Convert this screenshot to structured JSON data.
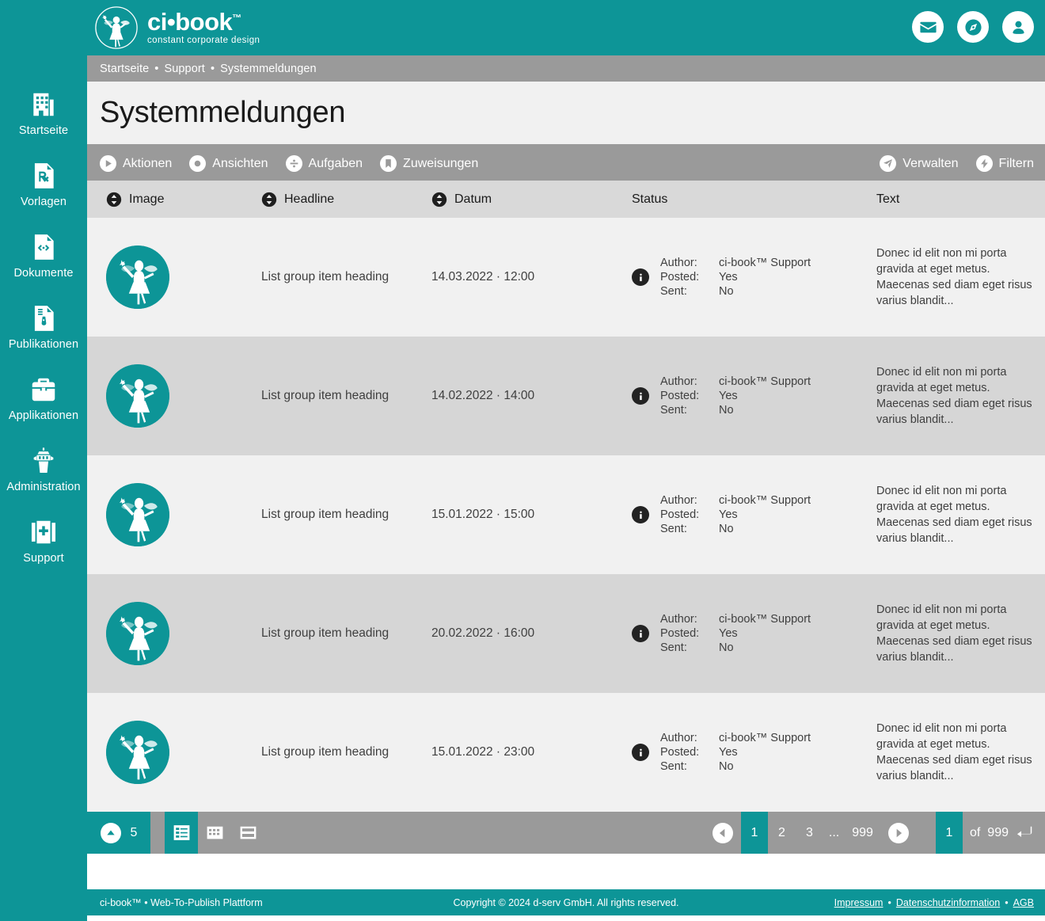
{
  "brand": {
    "name": "ci•book",
    "tm": "™",
    "tagline": "constant corporate design",
    "accent": "#0d9597",
    "toolbar_gray": "#9a9a9a",
    "row_light": "#f1f1f1",
    "row_dark": "#d6d6d6"
  },
  "header": {
    "icons": [
      {
        "name": "mail-icon",
        "label": "Nachrichten"
      },
      {
        "name": "compass-icon",
        "label": "Navigator"
      },
      {
        "name": "user-icon",
        "label": "Benutzerkonto"
      }
    ]
  },
  "sidebar": {
    "items": [
      {
        "label": "Startseite",
        "icon": "building-icon"
      },
      {
        "label": "Vorlagen",
        "icon": "prescription-document-icon"
      },
      {
        "label": "Dokumente",
        "icon": "code-document-icon"
      },
      {
        "label": "Publikationen",
        "icon": "publication-document-icon"
      },
      {
        "label": "Applikationen",
        "icon": "toolbox-icon"
      },
      {
        "label": "Administration",
        "icon": "control-tower-icon"
      },
      {
        "label": "Support",
        "icon": "first-aid-icon"
      }
    ]
  },
  "breadcrumb": {
    "items": [
      "Startseite",
      "Support",
      "Systemmeldungen"
    ],
    "separator": "•"
  },
  "page": {
    "title": "Systemmeldungen"
  },
  "toolbar": {
    "left": [
      {
        "label": "Aktionen",
        "icon": "play-circle-icon"
      },
      {
        "label": "Ansichten",
        "icon": "dot-circle-icon"
      },
      {
        "label": "Aufgaben",
        "icon": "divide-circle-icon"
      },
      {
        "label": "Zuweisungen",
        "icon": "bookmark-circle-icon"
      }
    ],
    "right": [
      {
        "label": "Verwalten",
        "icon": "paper-plane-circle-icon"
      },
      {
        "label": "Filtern",
        "icon": "bolt-circle-icon"
      }
    ]
  },
  "table": {
    "columns": [
      {
        "label": "Image",
        "sortable": true
      },
      {
        "label": "Headline",
        "sortable": true
      },
      {
        "label": "Datum",
        "sortable": true
      },
      {
        "label": "Status",
        "sortable": false
      },
      {
        "label": "Text",
        "sortable": false
      }
    ],
    "status_labels": {
      "author": "Author:",
      "posted": "Posted:",
      "sent": "Sent:"
    },
    "rows": [
      {
        "image": "fairy-avatar",
        "headline": "List group item heading",
        "date": "14.03.2022 · 12:00",
        "author": "ci-book™ Support",
        "posted": "Yes",
        "sent": "No",
        "text": "Donec id elit non mi porta gravida at eget metus. Maecenas sed diam eget risus varius blandit..."
      },
      {
        "image": "fairy-avatar",
        "headline": "List group item heading",
        "date": "14.02.2022 · 14:00",
        "author": "ci-book™ Support",
        "posted": "Yes",
        "sent": "No",
        "text": "Donec id elit non mi porta gravida at eget metus. Maecenas sed diam eget risus varius blandit..."
      },
      {
        "image": "fairy-avatar",
        "headline": "List group item heading",
        "date": "15.01.2022 · 15:00",
        "author": "ci-book™ Support",
        "posted": "Yes",
        "sent": "No",
        "text": "Donec id elit non mi porta gravida at eget metus. Maecenas sed diam eget risus varius blandit..."
      },
      {
        "image": "fairy-avatar",
        "headline": "List group item heading",
        "date": "20.02.2022 · 16:00",
        "author": "ci-book™ Support",
        "posted": "Yes",
        "sent": "No",
        "text": "Donec id elit non mi porta gravida at eget metus. Maecenas sed diam eget risus varius blandit..."
      },
      {
        "image": "fairy-avatar",
        "headline": "List group item heading",
        "date": "15.01.2022 · 23:00",
        "author": "ci-book™ Support",
        "posted": "Yes",
        "sent": "No",
        "text": "Donec id elit non mi porta gravida at eget metus. Maecenas sed diam eget risus varius blandit..."
      }
    ]
  },
  "pagination": {
    "page_size": "5",
    "views": [
      {
        "name": "list-view-icon",
        "active": true
      },
      {
        "name": "grid-view-icon",
        "active": false
      },
      {
        "name": "detail-view-icon",
        "active": false
      }
    ],
    "pages": [
      "1",
      "2",
      "3"
    ],
    "ellipsis": "...",
    "last_page": "999",
    "current_page": "1",
    "jump_value": "1",
    "of_label": "of",
    "total_pages": "999"
  },
  "footer": {
    "left": "ci-book™ • Web-To-Publish Plattform",
    "center": "Copyright © 2024 d-serv GmbH. All rights reserved.",
    "links": [
      "Impressum",
      "Datenschutzinformation",
      "AGB"
    ],
    "separator": "•"
  }
}
